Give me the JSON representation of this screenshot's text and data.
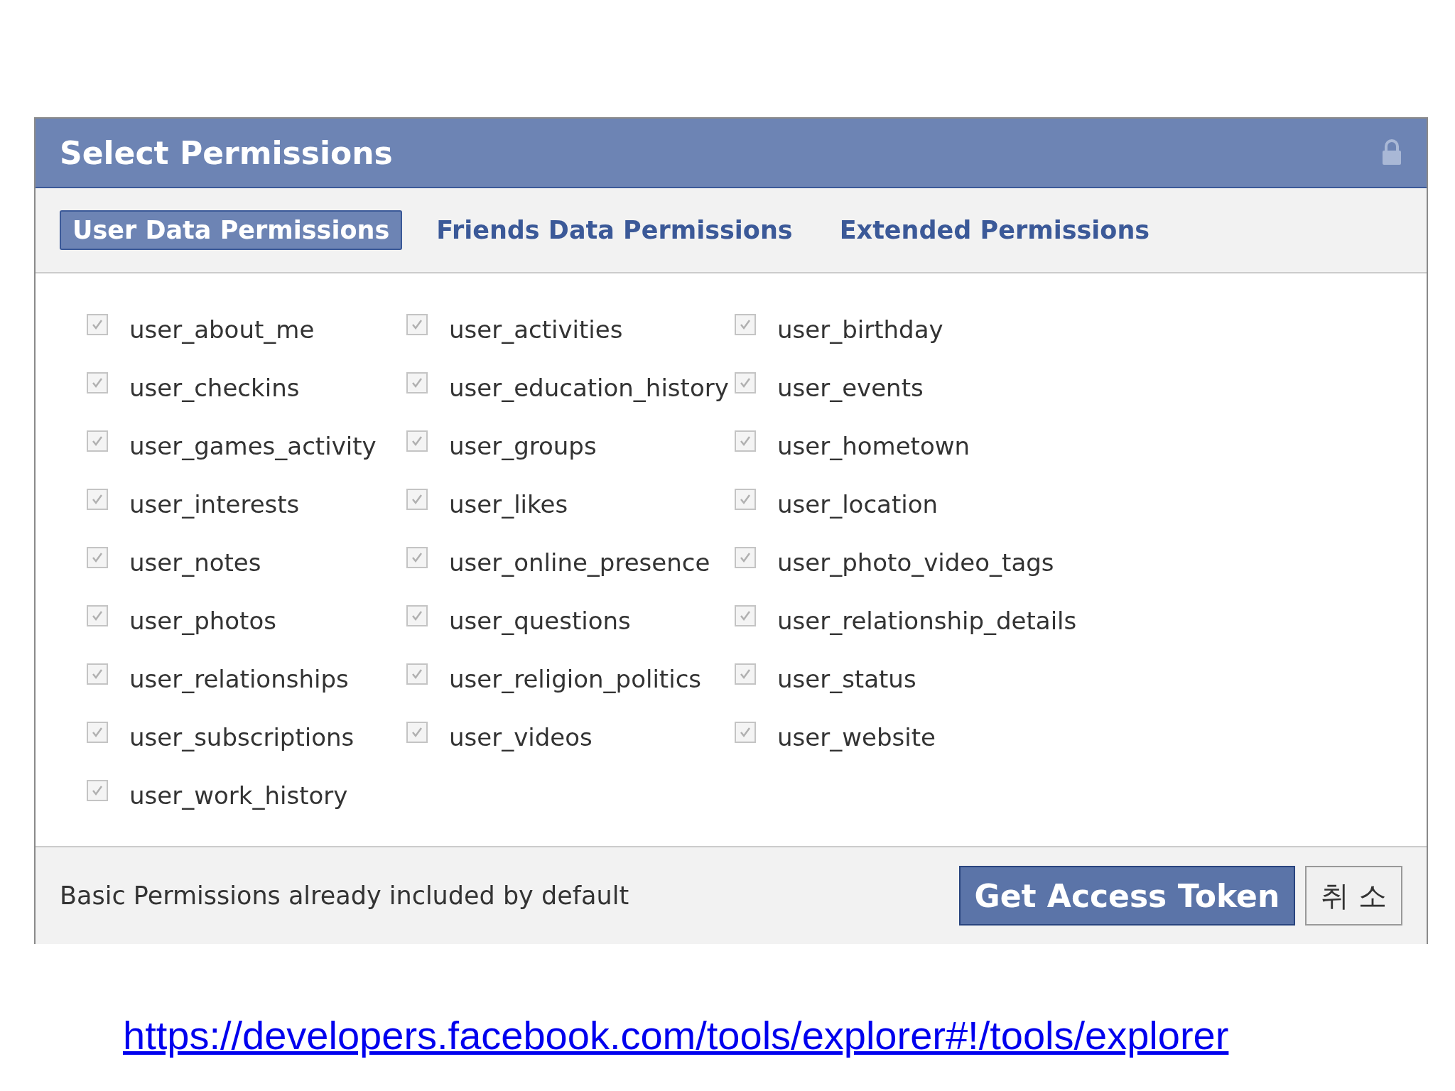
{
  "dialog": {
    "title": "Select Permissions",
    "locked": true
  },
  "tabs": [
    {
      "label": "User Data Permissions",
      "selected": true
    },
    {
      "label": "Friends Data Permissions",
      "selected": false
    },
    {
      "label": "Extended Permissions",
      "selected": false
    }
  ],
  "permissions": [
    {
      "label": "user_about_me",
      "checked": true,
      "disabled": true
    },
    {
      "label": "user_activities",
      "checked": true,
      "disabled": true
    },
    {
      "label": "user_birthday",
      "checked": true,
      "disabled": true
    },
    {
      "label": "user_checkins",
      "checked": true,
      "disabled": true
    },
    {
      "label": "user_education_history",
      "checked": true,
      "disabled": true
    },
    {
      "label": "user_events",
      "checked": true,
      "disabled": true
    },
    {
      "label": "user_games_activity",
      "checked": true,
      "disabled": true
    },
    {
      "label": "user_groups",
      "checked": true,
      "disabled": true
    },
    {
      "label": "user_hometown",
      "checked": true,
      "disabled": true
    },
    {
      "label": "user_interests",
      "checked": true,
      "disabled": true
    },
    {
      "label": "user_likes",
      "checked": true,
      "disabled": true
    },
    {
      "label": "user_location",
      "checked": true,
      "disabled": true
    },
    {
      "label": "user_notes",
      "checked": true,
      "disabled": true
    },
    {
      "label": "user_online_presence",
      "checked": true,
      "disabled": true
    },
    {
      "label": "user_photo_video_tags",
      "checked": true,
      "disabled": true
    },
    {
      "label": "user_photos",
      "checked": true,
      "disabled": true
    },
    {
      "label": "user_questions",
      "checked": true,
      "disabled": true
    },
    {
      "label": "user_relationship_details",
      "checked": true,
      "disabled": true
    },
    {
      "label": "user_relationships",
      "checked": true,
      "disabled": true
    },
    {
      "label": "user_religion_politics",
      "checked": true,
      "disabled": true
    },
    {
      "label": "user_status",
      "checked": true,
      "disabled": true
    },
    {
      "label": "user_subscriptions",
      "checked": true,
      "disabled": true
    },
    {
      "label": "user_videos",
      "checked": true,
      "disabled": true
    },
    {
      "label": "user_website",
      "checked": true,
      "disabled": true
    },
    {
      "label": "user_work_history",
      "checked": true,
      "disabled": true
    }
  ],
  "footer": {
    "note": "Basic Permissions already included by default",
    "buttons": [
      {
        "label": "Get Access Token",
        "kind": "primary"
      },
      {
        "label": "취 소",
        "kind": "secondary"
      }
    ]
  },
  "link": "https://developers.facebook.com/tools/explorer#!/tools/explorer"
}
